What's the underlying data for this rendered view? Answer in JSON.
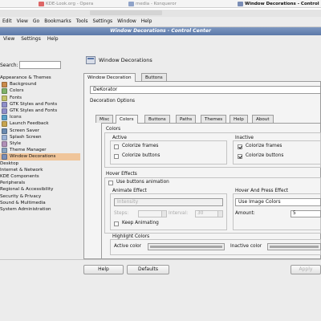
{
  "taskbar": {
    "tasks": [
      {
        "label": "KDE-Look.org - Opera",
        "state": "inactive"
      },
      {
        "label": "media - Konqueror",
        "state": "inactive"
      },
      {
        "label": "Window Decorations - Control",
        "state": "active"
      }
    ]
  },
  "bg_window": {
    "menu": [
      "Edit",
      "View",
      "Go",
      "Bookmarks",
      "Tools",
      "Settings",
      "Window",
      "Help"
    ]
  },
  "kcc": {
    "title": "Window Decorations - Control Center",
    "menu": [
      "View",
      "Settings",
      "Help"
    ],
    "search_label": "Search:",
    "tree": [
      {
        "label": "Appearance & Themes",
        "level": 0,
        "icon": "folder-icon"
      },
      {
        "label": "Background",
        "level": 1,
        "icon": "background-icon"
      },
      {
        "label": "Colors",
        "level": 1,
        "icon": "colors-icon"
      },
      {
        "label": "Fonts",
        "level": 1,
        "icon": "fonts-icon"
      },
      {
        "label": "GTK Styles and Fonts",
        "level": 1,
        "icon": "gtk-icon"
      },
      {
        "label": "GTK Styles and Fonts",
        "level": 1,
        "icon": "gtk-icon"
      },
      {
        "label": "Icons",
        "level": 1,
        "icon": "icons-icon"
      },
      {
        "label": "Launch Feedback",
        "level": 1,
        "icon": "launch-icon"
      },
      {
        "label": "Screen Saver",
        "level": 1,
        "icon": "screensaver-icon"
      },
      {
        "label": "Splash Screen",
        "level": 1,
        "icon": "splash-icon"
      },
      {
        "label": "Style",
        "level": 1,
        "icon": "style-icon"
      },
      {
        "label": "Theme Manager",
        "level": 1,
        "icon": "theme-icon"
      },
      {
        "label": "Window Decorations",
        "level": 1,
        "icon": "window-decorations-icon",
        "selected": true
      },
      {
        "label": "Desktop",
        "level": 0,
        "icon": "folder-icon"
      },
      {
        "label": "Internet & Network",
        "level": 0,
        "icon": "folder-icon"
      },
      {
        "label": "KDE Components",
        "level": 0,
        "icon": "folder-icon"
      },
      {
        "label": "Peripherals",
        "level": 0,
        "icon": "folder-icon"
      },
      {
        "label": "Regional & Accessibility",
        "level": 0,
        "icon": "folder-icon"
      },
      {
        "label": "Security & Privacy",
        "level": 0,
        "icon": "folder-icon"
      },
      {
        "label": "Sound & Multimedia",
        "level": 0,
        "icon": "folder-icon"
      },
      {
        "label": "System Administration",
        "level": 0,
        "icon": "folder-icon"
      }
    ],
    "page_title": "Window Decorations",
    "top_tabs": [
      "Window Decoration",
      "Buttons"
    ],
    "decoration_value": "DeKorator",
    "decoration_options_label": "Decoration Options",
    "inner_tabs": [
      "Misc",
      "Colors",
      "Buttons",
      "Paths",
      "Themes",
      "Help",
      "About"
    ],
    "colors": {
      "group_label": "Colors",
      "active_label": "Active",
      "inactive_label": "Inactive",
      "active_items": [
        {
          "label": "Colorize frames",
          "checked": false
        },
        {
          "label": "Colorize buttons",
          "checked": false
        }
      ],
      "inactive_items": [
        {
          "label": "Colorize frames",
          "checked": true
        },
        {
          "label": "Colorize buttons",
          "checked": true
        }
      ]
    },
    "hover": {
      "group_label": "Hover Effects",
      "use_anim_label": "Use buttons animation",
      "use_anim_checked": false,
      "anim_label": "Animate Effect",
      "anim_value": "Intensity",
      "steps_label": "Steps:",
      "steps_value": "",
      "interval_label": "Interval:",
      "interval_value": "30",
      "keep_anim_label": "Keep Animating",
      "keep_anim_checked": false,
      "press_label": "Hover And Press Effect",
      "press_value": "Use Image Colors",
      "amount_label": "Amount:",
      "amount_value": "5"
    },
    "highlight": {
      "group_label": "Highlight Colors",
      "active_label": "Active color",
      "inactive_label": "Inactive color",
      "active_color": "#a6a6a6",
      "inactive_color": "#a6a6a6"
    },
    "buttons": {
      "help": "Help",
      "defaults": "Defaults",
      "apply": "Apply"
    }
  }
}
